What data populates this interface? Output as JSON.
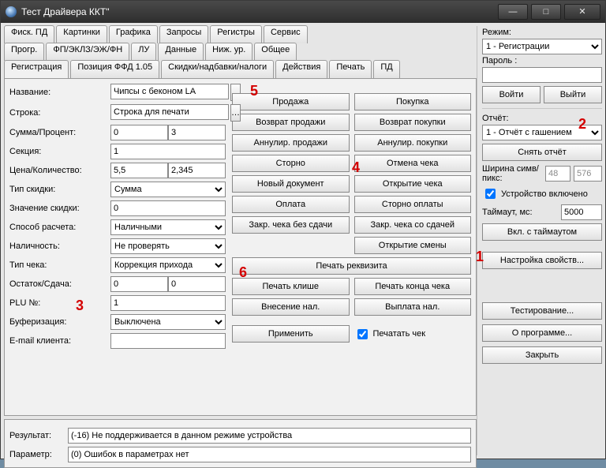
{
  "window": {
    "title": "Тест Драйвера ККТ\""
  },
  "tabs": {
    "row1": [
      "Фиск. ПД",
      "Картинки",
      "Графика",
      "Запросы",
      "Регистры",
      "Сервис"
    ],
    "row2": [
      "Прогр.",
      "ФП/ЭКЛЗ/ЭЖ/ФН",
      "ЛУ",
      "Данные",
      "Ниж. ур.",
      "Общее"
    ],
    "row3": [
      "Регистрация",
      "Позиция ФФД 1.05",
      "Скидки/надбавки/налоги",
      "Действия",
      "Печать",
      "ПД"
    ],
    "active": "Регистрация"
  },
  "labels": {
    "name": "Название:",
    "line": "Строка:",
    "sum_percent": "Сумма/Процент:",
    "section": "Секция:",
    "price_qty": "Цена/Количество:",
    "disc_type": "Тип скидки:",
    "disc_val": "Значение скидки:",
    "pay_method": "Способ расчета:",
    "cash": "Наличность:",
    "check_type": "Тип чека:",
    "remain_change": "Остаток/Сдача:",
    "plu": "PLU №:",
    "buffering": "Буферизация:",
    "email": "E-mail клиента:",
    "result": "Результат:",
    "param": "Параметр:"
  },
  "values": {
    "name": "Чипсы с беконом LA",
    "line": "Строка для печати",
    "sum": "0",
    "percent": "3",
    "section": "1",
    "price": "5,5",
    "qty": "2,345",
    "disc_type": "Сумма",
    "disc_val": "0",
    "pay_method": "Наличными",
    "cash": "Не проверять",
    "check_type": "Коррекция прихода",
    "remain": "0",
    "change": "0",
    "plu": "1",
    "buffering": "Выключена",
    "email": "",
    "result": "(-16) Не поддерживается в данном режиме устройства",
    "param": "(0) Ошибок в параметрах нет"
  },
  "ops": {
    "sale": "Продажа",
    "buy": "Покупка",
    "ret_sale": "Возврат продажи",
    "ret_buy": "Возврат покупки",
    "ann_sale": "Аннулир. продажи",
    "ann_buy": "Аннулир. покупки",
    "storno": "Сторно",
    "cancel_check": "Отмена чека",
    "new_doc": "Новый документ",
    "open_check": "Открытие чека",
    "pay": "Оплата",
    "storno_pay": "Сторно оплаты",
    "close_nochange": "Закр. чека без сдачи",
    "close_change": "Закр. чека со сдачей",
    "open_shift": "Открытие смены",
    "print_req": "Печать реквизита",
    "print_cliche": "Печать клише",
    "print_end": "Печать конца чека",
    "cash_in": "Внесение нал.",
    "cash_out": "Выплата нал.",
    "apply": "Применить",
    "print_check_chk": "Печатать чек"
  },
  "side": {
    "mode_lbl": "Режим:",
    "mode_val": "1 - Регистрации",
    "pass_lbl": "Пароль :",
    "pass_val": "",
    "login": "Войти",
    "logout": "Выйти",
    "report_lbl": "Отчёт:",
    "report_val": "1 - Отчёт с гашением",
    "take_report": "Снять отчёт",
    "width_lbl": "Ширина симв/пикс:",
    "w_chars": "48",
    "w_px": "576",
    "dev_on": "Устройство включено",
    "timeout_lbl": "Таймаут, мс:",
    "timeout_val": "5000",
    "on_timeout": "Вкл. с таймаутом",
    "props": "Настройка свойств...",
    "testing": "Тестирование...",
    "about": "О программе...",
    "close": "Закрыть"
  },
  "marks": {
    "m1": "1",
    "m2": "2",
    "m3": "3",
    "m4": "4",
    "m5": "5",
    "m6": "6"
  }
}
